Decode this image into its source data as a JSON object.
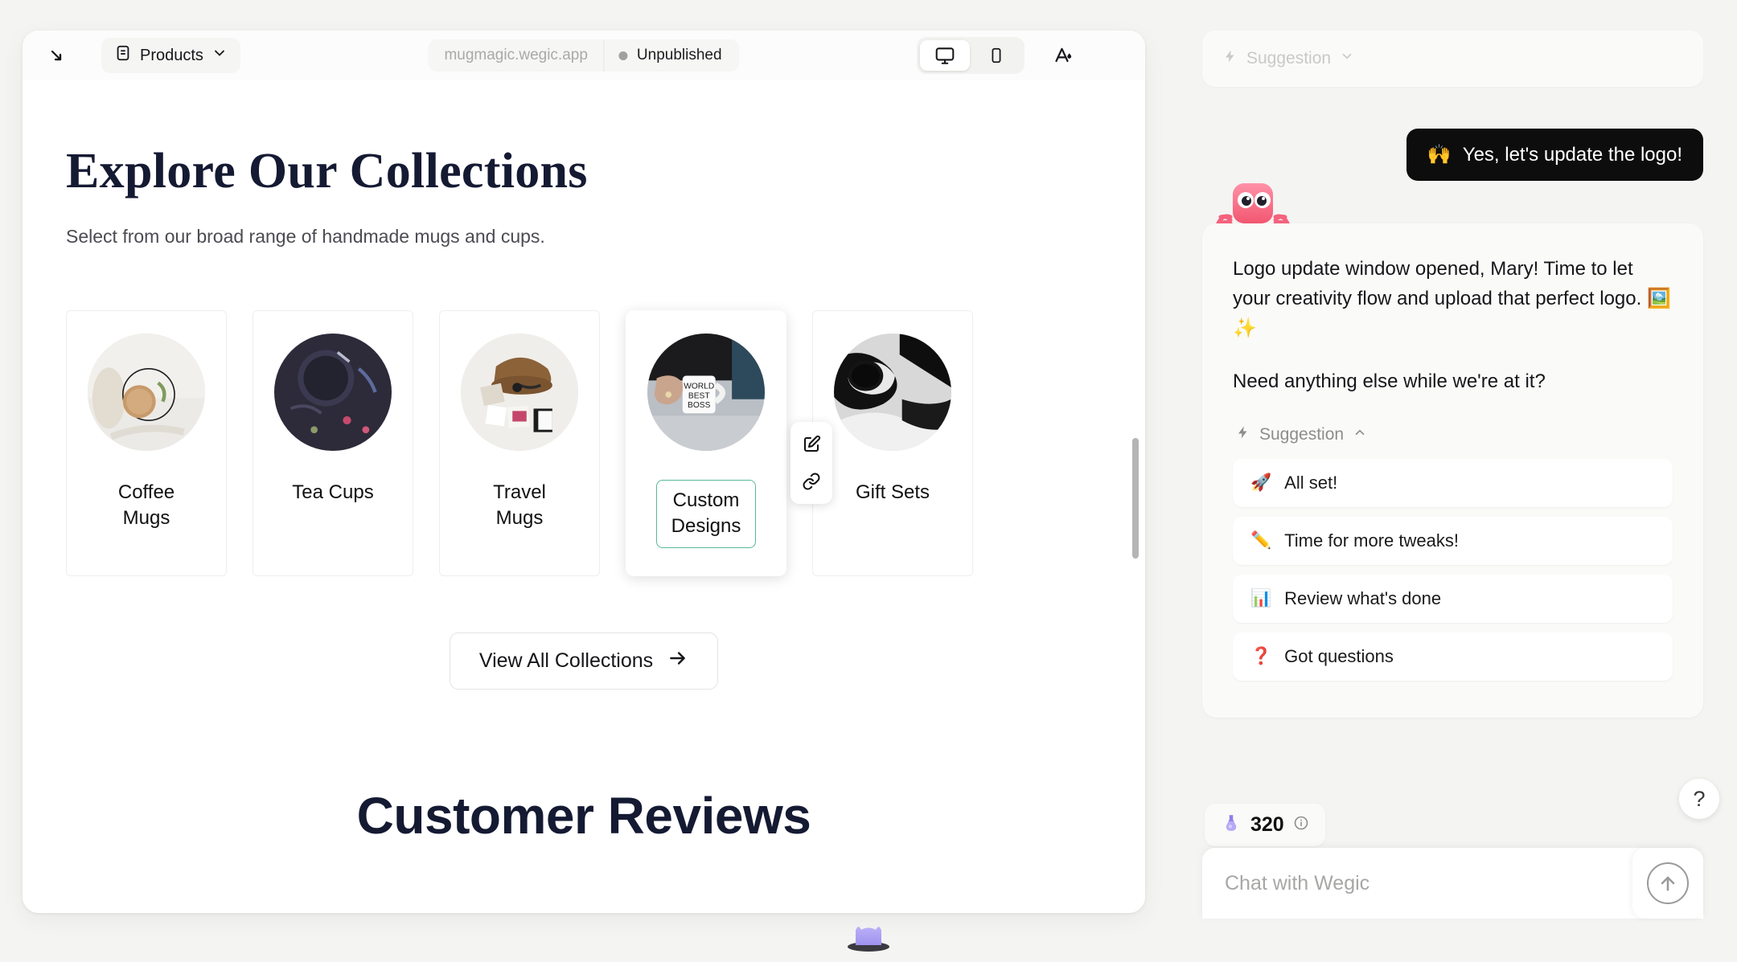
{
  "editor": {
    "expand_icon": "expand-diagonal-icon",
    "page_selector": {
      "label": "Products",
      "icon": "document-icon",
      "chevron": "chevron-down-icon"
    },
    "address": "mugmagic.wegic.app",
    "publish_status": "Unpublished",
    "view_modes": [
      {
        "name": "desktop",
        "icon": "monitor-icon",
        "active": true
      },
      {
        "name": "mobile",
        "icon": "phone-icon",
        "active": false
      }
    ],
    "theme_button": {
      "icon": "typography-color-icon"
    }
  },
  "site": {
    "hero_title": "Explore Our Collections",
    "hero_subtitle": "Select from our broad range of handmade mugs and cups.",
    "cards": [
      {
        "label_line1": "Coffee",
        "label_line2": "Mugs",
        "selected": false
      },
      {
        "label_line1": "Tea Cups",
        "label_line2": "",
        "selected": false
      },
      {
        "label_line1": "Travel",
        "label_line2": "Mugs",
        "selected": false
      },
      {
        "label_line1": "Custom",
        "label_line2": "Designs",
        "selected": true
      },
      {
        "label_line1": "Gift Sets",
        "label_line2": "",
        "selected": false
      }
    ],
    "view_all_label": "View All Collections",
    "view_all_arrow": "arrow-right-icon",
    "reviews_title": "Customer Reviews",
    "edit_tools": [
      {
        "name": "edit-element-icon"
      },
      {
        "name": "link-element-icon"
      }
    ]
  },
  "chat": {
    "ghost_suggestion": {
      "label": "Suggestion",
      "icon": "lightning-icon",
      "chevron": "chevron-down-icon"
    },
    "user_message": {
      "emoji": "🙌",
      "text": "Yes, let's update the logo!"
    },
    "bot_paragraph_1": "Logo update window opened, Mary! Time to let your creativity flow and upload that perfect logo. 🖼️ ✨",
    "bot_paragraph_2": "Need anything else while we're at it?",
    "suggestion_header": {
      "label": "Suggestion",
      "icon": "lightning-icon",
      "chevron": "chevron-up-icon"
    },
    "suggestions": [
      {
        "emoji": "🚀",
        "label": "All set!"
      },
      {
        "emoji": "✏️",
        "label": "Time for more tweaks!"
      },
      {
        "emoji": "📊",
        "label": "Review what's done"
      },
      {
        "emoji": "❓",
        "label": "Got questions"
      }
    ],
    "credits": {
      "icon": "potion-icon",
      "count": "320",
      "info_icon": "info-icon"
    },
    "help_button": "?",
    "input_placeholder": "Chat with Wegic",
    "input_value": "",
    "send_icon": "arrow-up-circle-icon"
  },
  "colors": {
    "accent_selection": "#59b89b",
    "user_bubble_bg": "#0d0d0d",
    "page_bg": "#f4f4f2",
    "heading": "#151a33"
  }
}
